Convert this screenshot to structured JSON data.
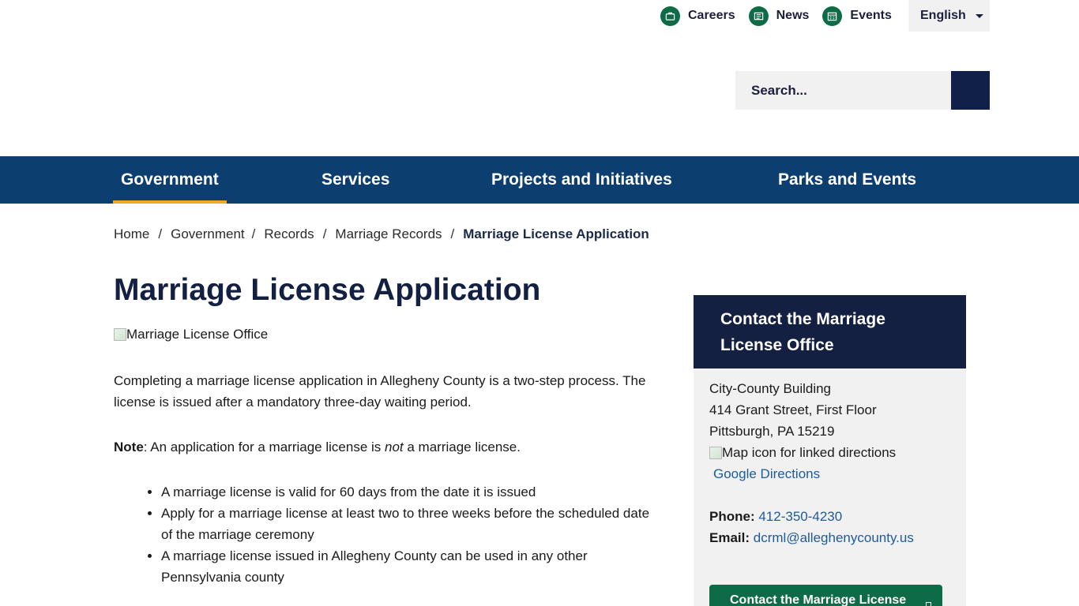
{
  "utility_nav": {
    "careers_label": "Careers",
    "news_label": "News",
    "events_label": "Events",
    "language_label": "English"
  },
  "search": {
    "placeholder": "Search..."
  },
  "main_nav": {
    "items": [
      {
        "label": "Government",
        "active": true
      },
      {
        "label": "Services",
        "active": false
      },
      {
        "label": "Projects and Initiatives",
        "active": false
      },
      {
        "label": "Parks and Events",
        "active": false
      }
    ]
  },
  "breadcrumb": {
    "items": [
      "Home",
      "Government",
      "Records",
      "Marriage Records"
    ],
    "current": "Marriage License Application",
    "separator": "/"
  },
  "content": {
    "title": "Marriage License Application",
    "image_alt": "Marriage License Office",
    "intro": "Completing a marriage license application in Allegheny County is a two-step process. The license is issued after a mandatory three-day waiting period.",
    "note_label": "Note",
    "note_text_1": ": An application for a marriage license is ",
    "note_emphasis": "not",
    "note_text_2": " a marriage license.",
    "bullets": [
      "A marriage license is valid for 60 days from the date it is issued",
      "Apply for a marriage license at least two to three weeks before the scheduled date of the marriage ceremony",
      "A marriage license issued in Allegheny County can be used in any other Pennsylvania county"
    ]
  },
  "sidebar": {
    "heading": "Contact the Marriage License Office",
    "address_line1": "City-County Building",
    "address_line2": "414 Grant Street, First Floor",
    "address_line3": "Pittsburgh, PA 15219",
    "map_alt": "Map icon for linked directions",
    "directions_label": "Google Directions",
    "phone_label": "Phone:",
    "phone": "412-350-4230",
    "email_label": "Email:",
    "email": "dcrml@alleghenycounty.us",
    "button_label": "Contact the Marriage License"
  },
  "colors": {
    "nav_bg": "#0d3e70",
    "active_underline": "#f0a81e",
    "title_navy": "#132042",
    "green_accent": "#0e6b48",
    "link_blue": "#1f5a99"
  },
  "icons": [
    "careers-icon",
    "news-icon",
    "events-icon",
    "chevron-down-icon",
    "search-icon",
    "broken-image-icon"
  ]
}
